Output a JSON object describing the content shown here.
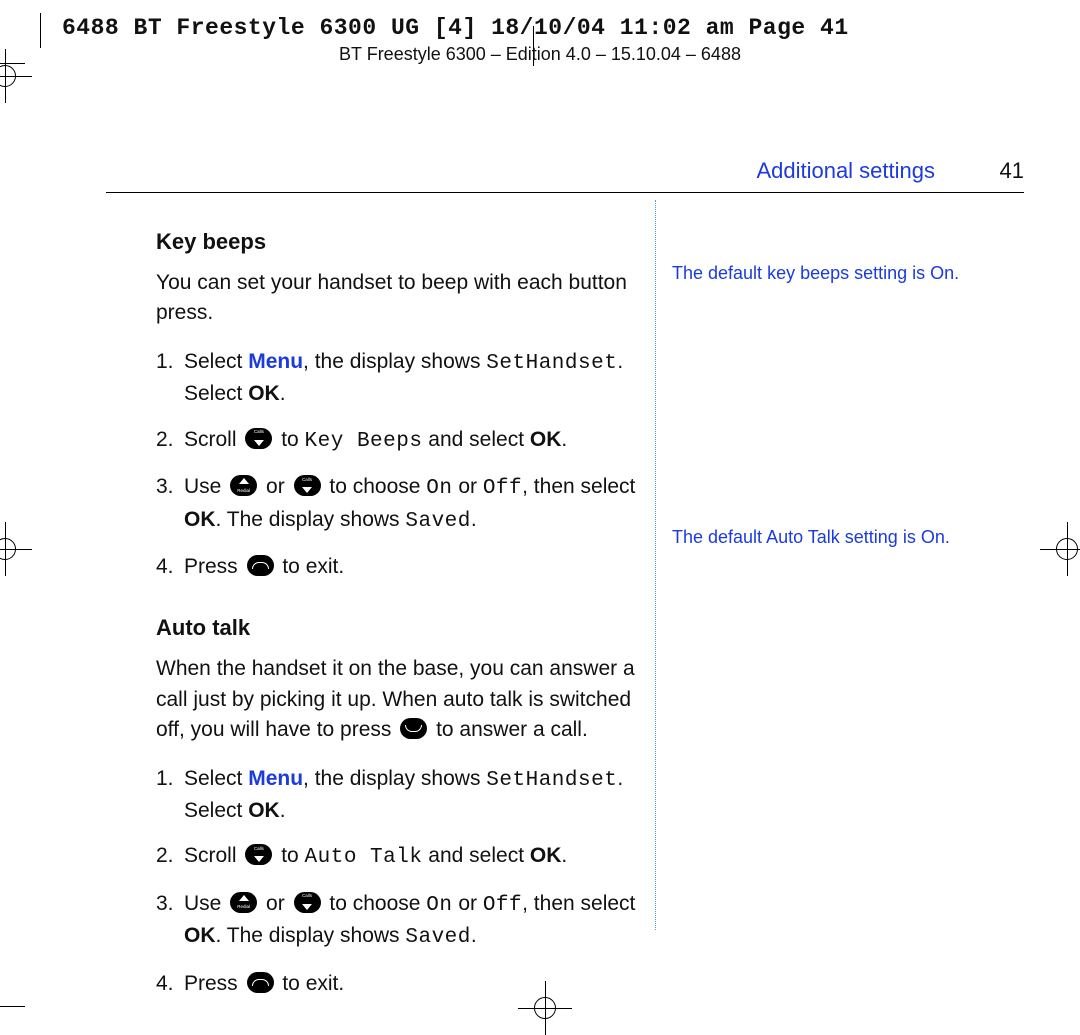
{
  "prepress_tag": "6488 BT Freestyle 6300 UG [4]  18/10/04  11:02 am  Page 41",
  "edition_line": "BT Freestyle 6300 – Edition 4.0 – 15.10.04 – 6488",
  "section_title": "Additional settings",
  "page_number": "41",
  "keybeeps": {
    "heading": "Key beeps",
    "intro": "You can set your handset to beep with each button press.",
    "step1_a": "Select ",
    "step1_menu": "Menu",
    "step1_b": ", the display shows ",
    "step1_lcd": "SetHandset",
    "step1_c": ". Select ",
    "step1_ok": "OK",
    "step1_d": ".",
    "step2_a": "Scroll ",
    "step2_b": " to ",
    "step2_lcd": "Key Beeps",
    "step2_c": " and select ",
    "step2_ok": "OK",
    "step2_d": ".",
    "step3_a": "Use ",
    "step3_b": " or ",
    "step3_c": " to choose ",
    "step3_lcd_on": "On",
    "step3_d": " or ",
    "step3_lcd_off": "Off",
    "step3_e": ", then select ",
    "step3_ok": "OK",
    "step3_f": ". The display shows ",
    "step3_lcd_saved": "Saved",
    "step3_g": ".",
    "step4_a": "Press ",
    "step4_b": " to exit."
  },
  "autotalk": {
    "heading": "Auto talk",
    "intro_a": "When the handset it on the base, you can answer a call just by picking it up. When auto talk is switched off, you will have to press ",
    "intro_b": " to answer a call.",
    "step1_a": "Select ",
    "step1_menu": "Menu",
    "step1_b": ", the display shows ",
    "step1_lcd": "SetHandset",
    "step1_c": ". Select ",
    "step1_ok": "OK",
    "step1_d": ".",
    "step2_a": "Scroll ",
    "step2_b": " to ",
    "step2_lcd": "Auto Talk",
    "step2_c": " and select ",
    "step2_ok": "OK",
    "step2_d": ".",
    "step3_a": "Use ",
    "step3_b": " or ",
    "step3_c": " to choose ",
    "step3_lcd_on": "On",
    "step3_d": " or ",
    "step3_lcd_off": "Off",
    "step3_e": ", then select ",
    "step3_ok": "OK",
    "step3_f": ". The display shows ",
    "step3_lcd_saved": "Saved",
    "step3_g": ".",
    "step4_a": "Press ",
    "step4_b": " to exit."
  },
  "side": {
    "note1": "The default key beeps setting is On.",
    "note2": "The default Auto Talk setting is On."
  },
  "nums": {
    "n1": "1.",
    "n2": "2.",
    "n3": "3.",
    "n4": "4."
  }
}
